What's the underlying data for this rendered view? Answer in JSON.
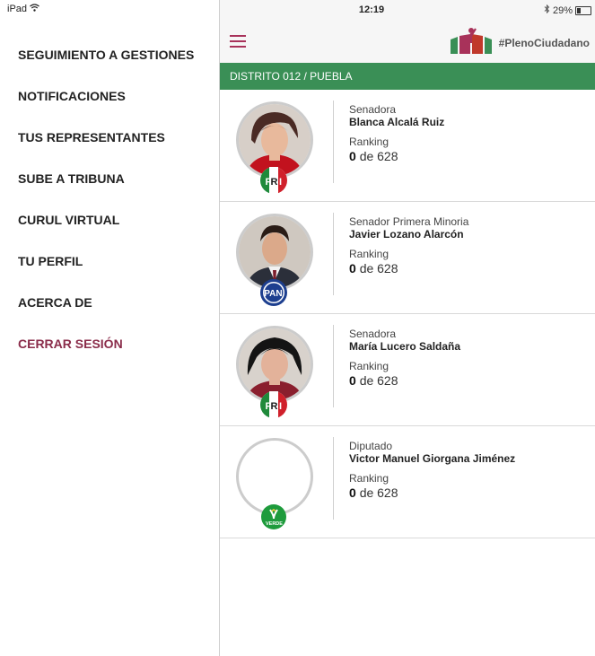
{
  "device": {
    "name": "iPad",
    "time": "12:19",
    "battery": "29%"
  },
  "menu": {
    "items": [
      {
        "label": "SEGUIMIENTO A GESTIONES"
      },
      {
        "label": "NOTIFICACIONES"
      },
      {
        "label": "TUS REPRESENTANTES"
      },
      {
        "label": "SUBE A TRIBUNA"
      },
      {
        "label": "CURUL VIRTUAL"
      },
      {
        "label": "TU PERFIL"
      },
      {
        "label": "ACERCA DE"
      }
    ],
    "logout_label": "CERRAR SESIÓN"
  },
  "header": {
    "hashtag": "#PlenoCiudadano",
    "accent": "#a8325a"
  },
  "district": {
    "label": "DISTRITO 012 / PUEBLA",
    "color": "#3a8f56"
  },
  "representatives": [
    {
      "role": "Senadora",
      "name": "Blanca Alcalá Ruiz",
      "ranking_label": "Ranking",
      "rank": "0",
      "rank_suffix": "de 628",
      "party": "PRI",
      "photo": "woman-short-hair"
    },
    {
      "role": "Senador Primera Minoria",
      "name": "Javier Lozano Alarcón",
      "ranking_label": "Ranking",
      "rank": "0",
      "rank_suffix": "de 628",
      "party": "PAN",
      "photo": "man-suit"
    },
    {
      "role": "Senadora",
      "name": "María Lucero Saldaña",
      "ranking_label": "Ranking",
      "rank": "0",
      "rank_suffix": "de 628",
      "party": "PRI",
      "photo": "woman-dark-hair"
    },
    {
      "role": "Diputado",
      "name": "Victor Manuel Giorgana Jiménez",
      "ranking_label": "Ranking",
      "rank": "0",
      "rank_suffix": "de 628",
      "party": "VERDE",
      "photo": ""
    }
  ],
  "icons": {
    "wifi": "wifi-icon",
    "bluetooth": "bluetooth-icon",
    "battery": "battery-icon",
    "menu": "hamburger-menu-icon",
    "logo": "pleno-ciudadano-logo"
  }
}
